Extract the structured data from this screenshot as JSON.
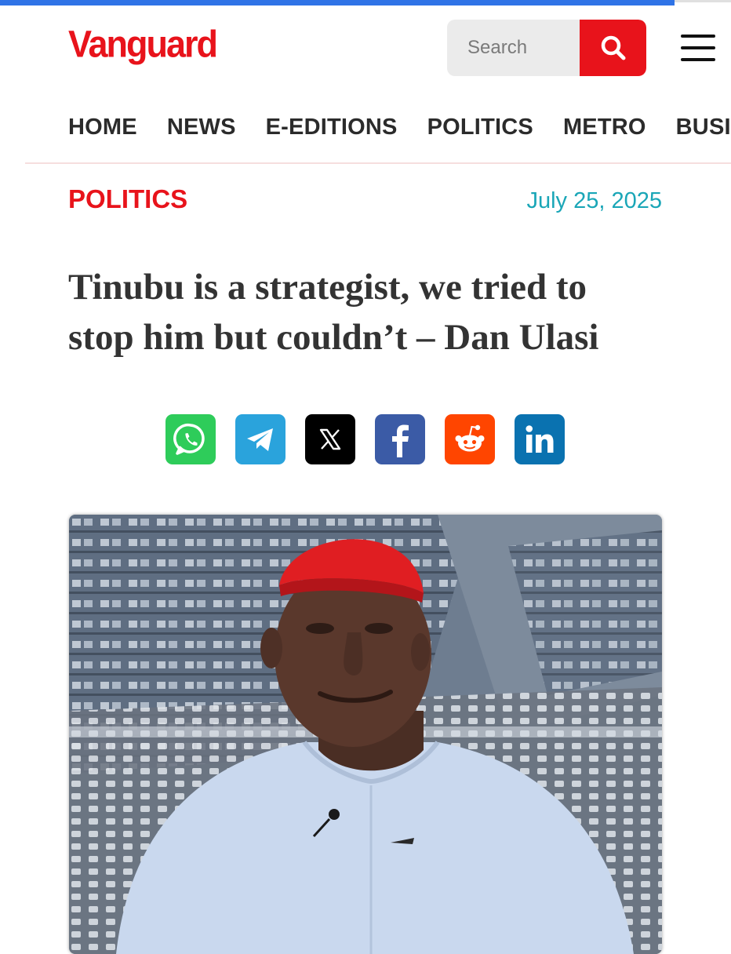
{
  "site": {
    "logo": "Vanguard",
    "brand_color": "#e8131b",
    "accent_bar_color": "#2f73e6"
  },
  "search": {
    "placeholder": "Search",
    "button_icon": "search-icon"
  },
  "menu": {
    "icon": "hamburger-menu-icon"
  },
  "nav": {
    "items": [
      "HOME",
      "NEWS",
      "E-EDITIONS",
      "POLITICS",
      "METRO",
      "BUSI"
    ]
  },
  "article": {
    "category": "POLITICS",
    "date": "July 25, 2025",
    "headline": "Tinubu is a strategist, we tried to stop him but couldn’t – Dan Ulasi",
    "image_icon": "article-photo"
  },
  "share": {
    "buttons": [
      {
        "name": "whatsapp",
        "icon": "whatsapp-icon",
        "color": "#2ecc5a"
      },
      {
        "name": "telegram",
        "icon": "telegram-icon",
        "color": "#2aa3dc"
      },
      {
        "name": "x",
        "icon": "x-icon",
        "color": "#000000"
      },
      {
        "name": "facebook",
        "icon": "facebook-icon",
        "color": "#3b5ba6"
      },
      {
        "name": "reddit",
        "icon": "reddit-icon",
        "color": "#ff4500"
      },
      {
        "name": "linkedin",
        "icon": "linkedin-icon",
        "color": "#0a72b0"
      }
    ]
  }
}
